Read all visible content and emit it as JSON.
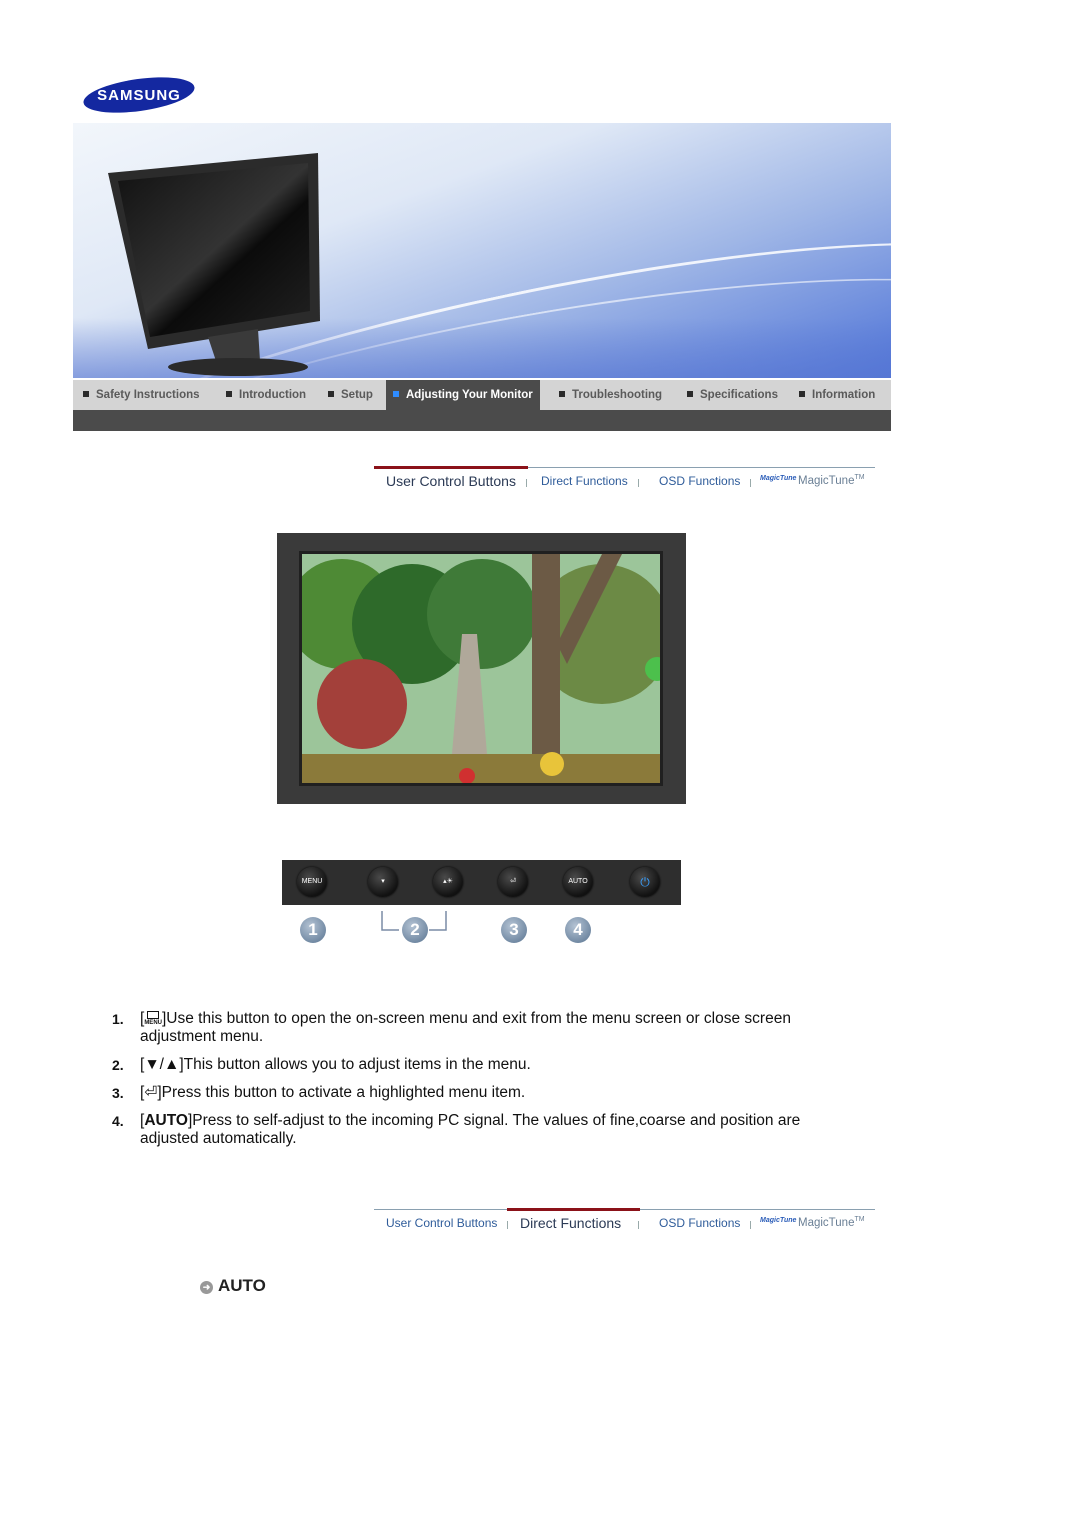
{
  "brand": {
    "logo_text": "SAMSUNG",
    "logo_color": "#1428a0"
  },
  "nav": {
    "items": [
      {
        "label": "Safety Instructions",
        "active": false
      },
      {
        "label": "Introduction",
        "active": false
      },
      {
        "label": "Setup",
        "active": false
      },
      {
        "label": "Adjusting Your Monitor",
        "active": true
      },
      {
        "label": "Troubleshooting",
        "active": false
      },
      {
        "label": "Specifications",
        "active": false
      },
      {
        "label": "Information",
        "active": false
      }
    ]
  },
  "subtabs_top": {
    "active": "User Control Buttons",
    "items": [
      "User Control Buttons",
      "Direct Functions",
      "OSD Functions"
    ],
    "magictune_logo": "MagicTune",
    "magictune_label": "MagicTune",
    "tm": "TM"
  },
  "control_panel": {
    "buttons": [
      {
        "icon": "menu-icon",
        "label": "MENU"
      },
      {
        "icon": "brightness-down-icon",
        "label": "▾"
      },
      {
        "icon": "brightness-up-icon",
        "label": "▴☀"
      },
      {
        "icon": "enter-icon",
        "label": "⏎"
      },
      {
        "icon": "auto-icon",
        "label": "AUTO"
      },
      {
        "icon": "power-icon",
        "label": "⏻"
      }
    ],
    "badges": [
      "1",
      "2",
      "3",
      "4"
    ]
  },
  "instructions": [
    {
      "num": "1.",
      "key": "MENU",
      "text": "]Use this button to open the on-screen menu and exit from the menu screen or close screen adjustment menu."
    },
    {
      "num": "2.",
      "key": "▼/▲",
      "text": "]This button allows you to adjust items in the menu."
    },
    {
      "num": "3.",
      "key": "⏎",
      "text": "]Press this button to activate a highlighted menu item."
    },
    {
      "num": "4.",
      "key": "AUTO",
      "text": "]Press to self-adjust to the incoming PC signal. The values of fine,coarse and position are adjusted automatically."
    }
  ],
  "subtabs_bottom": {
    "active": "Direct Functions",
    "items": [
      "User Control Buttons",
      "Direct Functions",
      "OSD Functions"
    ],
    "magictune_logo": "MagicTune",
    "magictune_label": "MagicTune",
    "tm": "TM"
  },
  "section_heading": {
    "label": "AUTO"
  }
}
